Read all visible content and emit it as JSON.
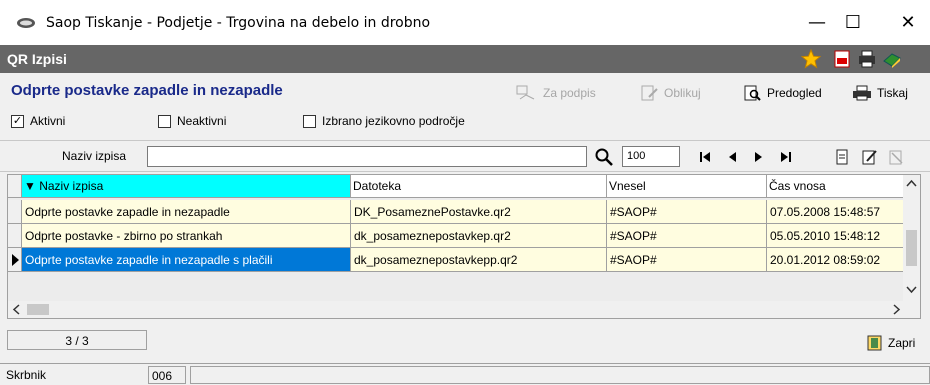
{
  "window": {
    "title": "Saop Tiskanje - Podjetje - Trgovina na debelo in drobno",
    "minimize": "—",
    "maximize": "☐",
    "close": "✕"
  },
  "module": {
    "title": "QR Izpisi"
  },
  "page": {
    "title": "Odprte postavke zapadle in nezapadle"
  },
  "toolbar": {
    "za_podpis": "Za podpis",
    "oblikuj": "Oblikuj",
    "predogled": "Predogled",
    "tiskaj": "Tiskaj"
  },
  "filters": {
    "aktivni": {
      "label": "Aktivni",
      "checked": true
    },
    "neaktivni": {
      "label": "Neaktivni",
      "checked": false
    },
    "jezik": {
      "label": "Izbrano jezikovno področje",
      "checked": false
    }
  },
  "search": {
    "label": "Naziv izpisa",
    "value": "",
    "zoom": "100"
  },
  "grid": {
    "columns": [
      "Naziv izpisa",
      "Datoteka",
      "Vnesel",
      "Čas vnosa"
    ],
    "rows": [
      [
        "Odprte postavke zapadle in nezapadle",
        "DK_PosameznePostavke.qr2",
        "#SAOP#",
        "07.05.2008 15:48:57"
      ],
      [
        "Odprte postavke - zbirno po strankah",
        "dk_posameznepostavkep.qr2",
        "#SAOP#",
        "05.05.2010 15:48:12"
      ],
      [
        "Odprte postavke zapadle in nezapadle s plačili",
        "dk_posameznepostavkepp.qr2",
        "#SAOP#",
        "20.01.2012 08:59:02"
      ]
    ]
  },
  "status": {
    "counter": "3 / 3",
    "zapri": "Zapri"
  },
  "footer": {
    "user_label": "Skrbnik",
    "code": "006"
  },
  "colors": {
    "accent": "#0078d7",
    "title_blue": "#1a2a8a",
    "row_bg": "#fffde0",
    "sorted_header": "#00ffff"
  }
}
